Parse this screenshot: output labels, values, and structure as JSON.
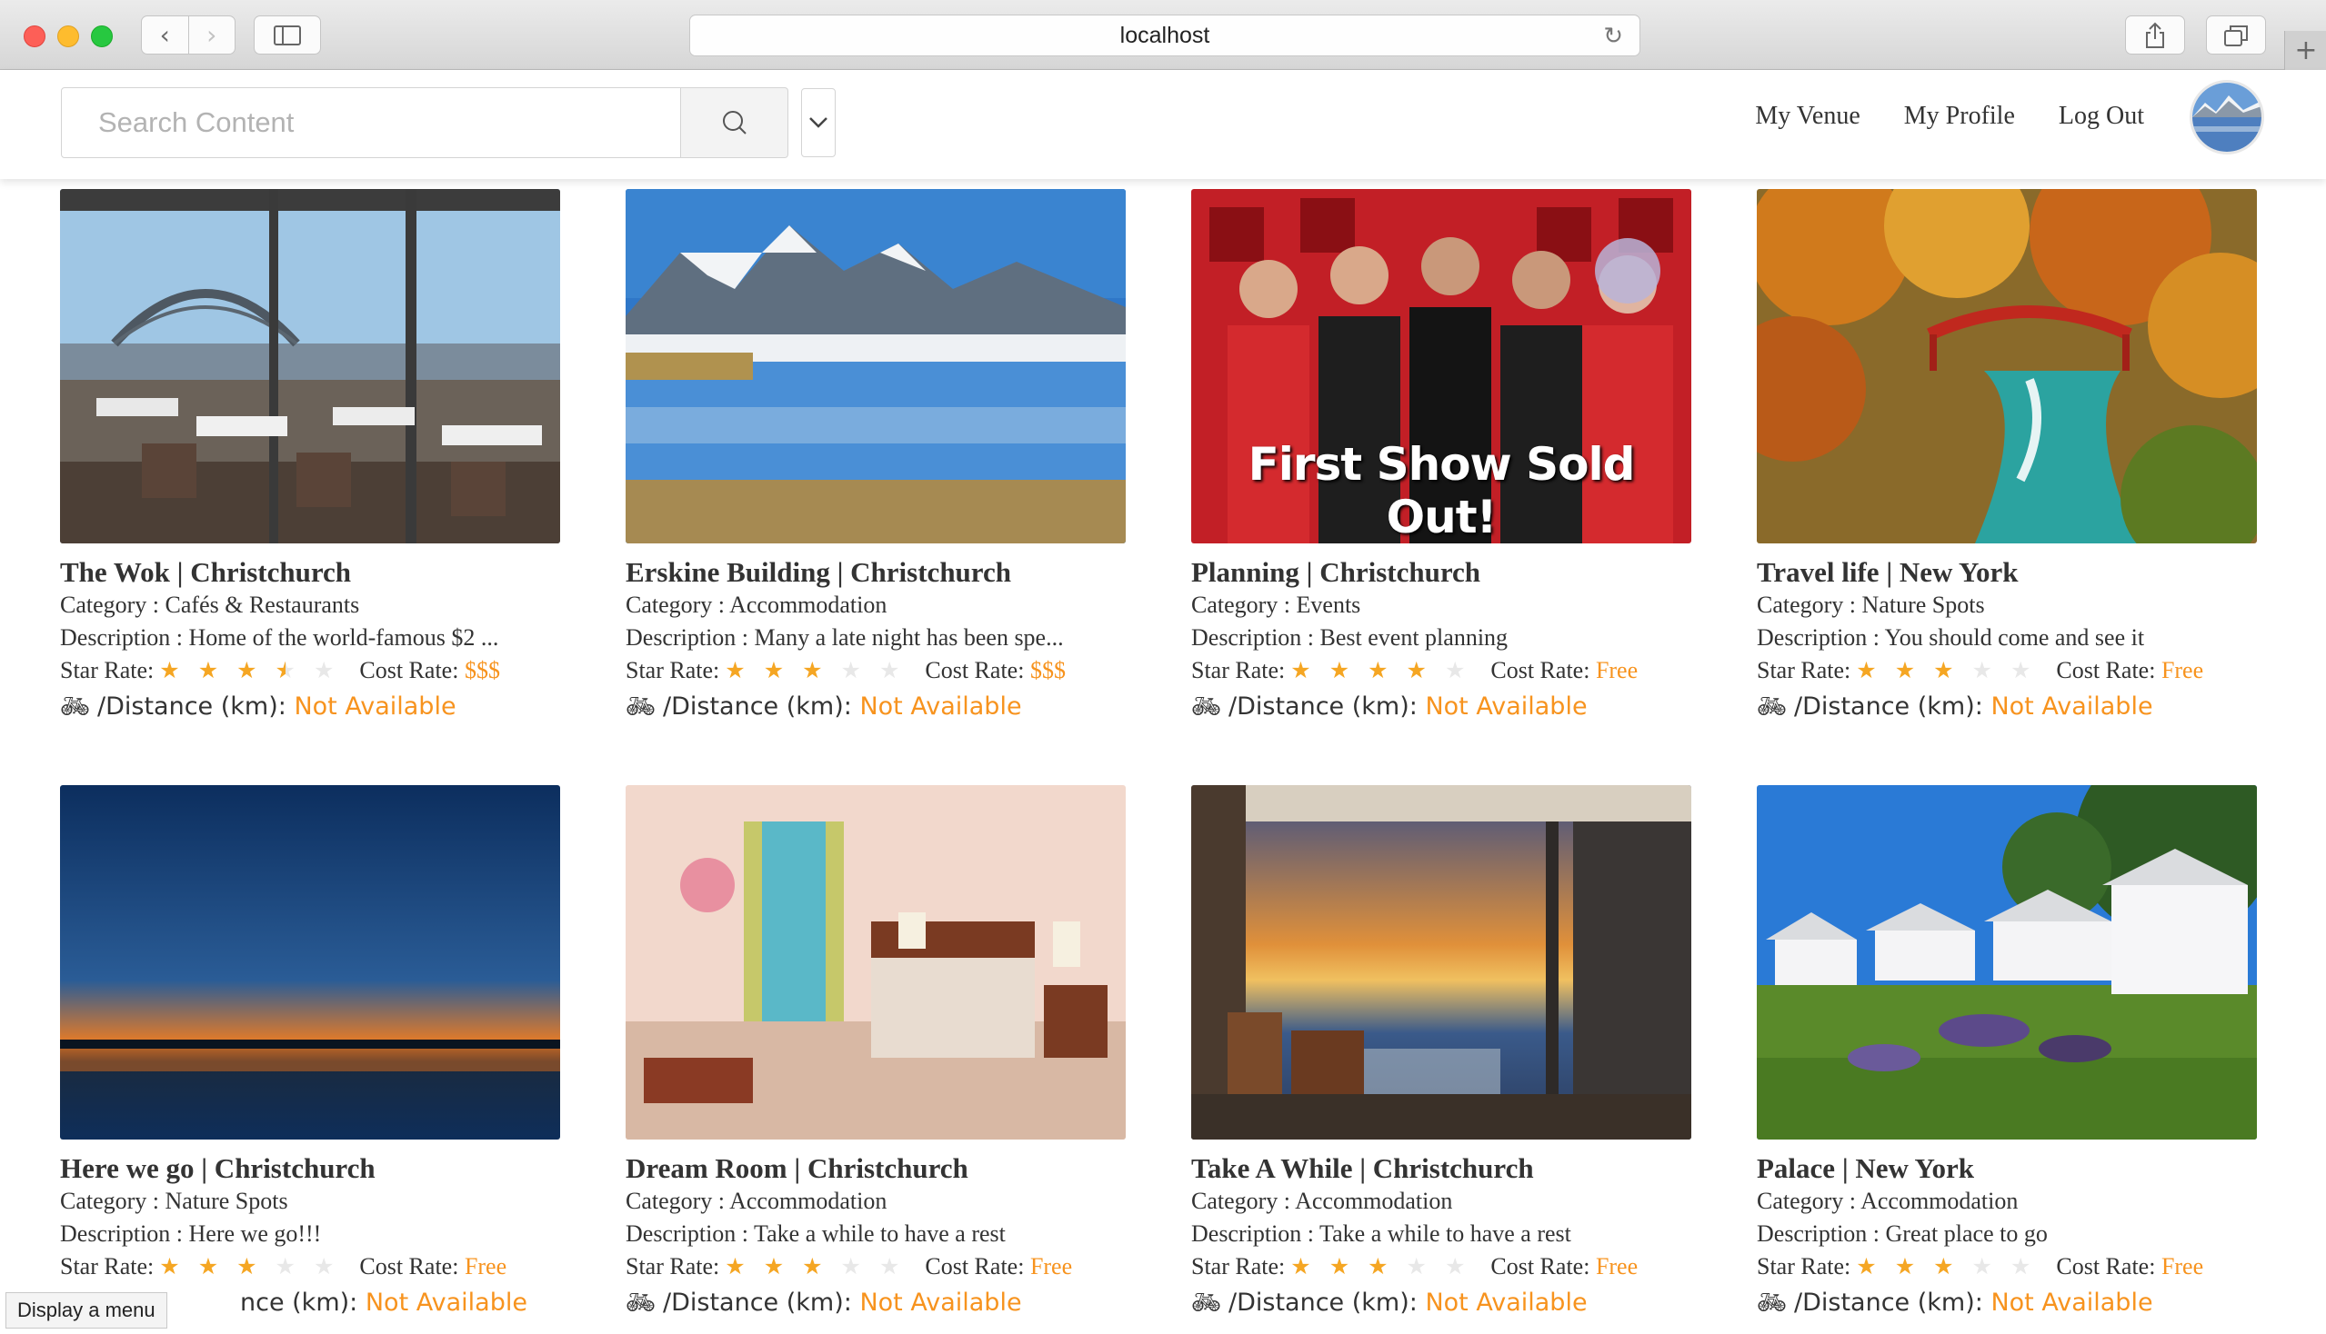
{
  "browser": {
    "url": "localhost"
  },
  "header": {
    "search_placeholder": "Search Content",
    "nav": [
      "My Venue",
      "My Profile",
      "Log Out"
    ]
  },
  "labels": {
    "star_rate": "Star Rate:",
    "cost_rate": "Cost Rate:",
    "distance": "/Distance (km):",
    "distance_cut": "nce (km):"
  },
  "cards": [
    {
      "title": "The Wok | Christchurch",
      "category": "Category : Cafés & Restaurants",
      "description": "Description : Home of the world-famous $2 ...",
      "stars": 3.5,
      "cost": "$$$",
      "distance": "Not Available"
    },
    {
      "title": "Erskine Building | Christchurch",
      "category": "Category : Accommodation",
      "description": "Description : Many a late night has been spe...",
      "stars": 3,
      "cost": "$$$",
      "distance": "Not Available"
    },
    {
      "title": "Planning | Christchurch",
      "category": "Category : Events",
      "description": "Description : Best event planning",
      "stars": 4,
      "cost": "Free",
      "distance": "Not Available",
      "photo_caption": "First Show Sold Out!"
    },
    {
      "title": "Travel life | New York",
      "category": "Category : Nature Spots",
      "description": "Description : You should come and see it",
      "stars": 3,
      "cost": "Free",
      "distance": "Not Available"
    },
    {
      "title": "Here we go | Christchurch",
      "category": "Category : Nature Spots",
      "description": "Description : Here we go!!!",
      "stars": 3,
      "cost": "Free",
      "distance": "Not Available"
    },
    {
      "title": "Dream Room | Christchurch",
      "category": "Category : Accommodation",
      "description": "Description : Take a while to have a rest",
      "stars": 3,
      "cost": "Free",
      "distance": "Not Available"
    },
    {
      "title": "Take A While | Christchurch",
      "category": "Category : Accommodation",
      "description": "Description : Take a while to have a rest",
      "stars": 3,
      "cost": "Free",
      "distance": "Not Available"
    },
    {
      "title": "Palace | New York",
      "category": "Category : Accommodation",
      "description": "Description : Great place to go",
      "stars": 3,
      "cost": "Free",
      "distance": "Not Available"
    }
  ],
  "tooltip": "Display a menu",
  "colors": {
    "accent": "#f7931e",
    "star": "#f5a623",
    "star_off": "#e8e8e8"
  }
}
